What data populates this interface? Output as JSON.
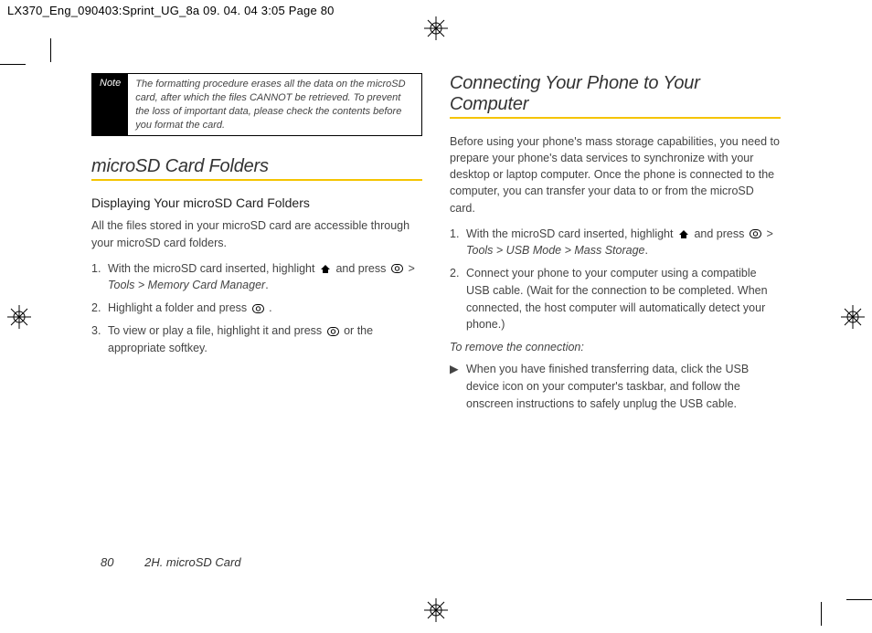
{
  "print_header": "LX370_Eng_090403:Sprint_UG_8a  09. 04. 04      3:05  Page 80",
  "note": {
    "label": "Note",
    "body": "The formatting procedure erases all the data on the microSD card, after which the files CANNOT be retrieved. To prevent the loss of important data, please check the contents before you format the card."
  },
  "left": {
    "h1": "microSD Card Folders",
    "h2": "Displaying Your microSD Card Folders",
    "intro": "All the files stored in your microSD card are accessible through your microSD card folders.",
    "steps": [
      {
        "n": "1.",
        "pre": "With the microSD card inserted, highlight ",
        "post": " and press ",
        "path": " > Tools > Memory Card Manager",
        "tail": "."
      },
      {
        "n": "2.",
        "pre": "Highlight a folder and press ",
        "post": ".",
        "path": "",
        "tail": ""
      },
      {
        "n": "3.",
        "pre": "To view or play a file, highlight it and press ",
        "post": " or the appropriate softkey.",
        "path": "",
        "tail": ""
      }
    ]
  },
  "right": {
    "h1": "Connecting Your Phone to Your Computer",
    "intro": "Before using your phone's mass storage capabilities, you need to prepare your phone's data services to synchronize with your desktop or laptop computer. Once the phone is connected to the computer, you can transfer your data to or from the microSD card.",
    "steps": [
      {
        "n": "1.",
        "pre": "With the microSD card inserted, highlight ",
        "post": " and press ",
        "path": " > Tools > USB Mode > Mass Storage",
        "tail": "."
      },
      {
        "n": "2.",
        "pre": "Connect your phone to your computer using a compatible USB cable. (Wait for the connection to be completed. When connected, the host computer will automatically detect your phone.)",
        "post": "",
        "path": "",
        "tail": ""
      }
    ],
    "sub": "To remove the connection:",
    "bullets": [
      "When you have finished transferring data, click the USB device icon on your computer's taskbar, and follow the onscreen instructions to safely unplug the USB cable."
    ]
  },
  "footer": {
    "page": "80",
    "section": "2H. microSD Card"
  },
  "glyphs": {
    "gt": ">",
    "arrow": "▶"
  }
}
